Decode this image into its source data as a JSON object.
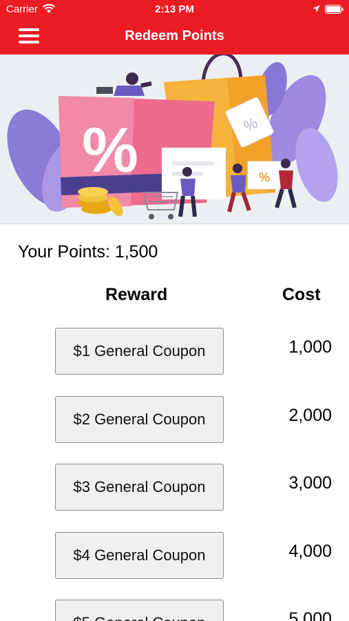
{
  "status_bar": {
    "carrier": "Carrier",
    "time": "2:13 PM",
    "icons": [
      "wifi-icon",
      "location-arrow-icon",
      "battery-icon"
    ]
  },
  "header": {
    "title": "Redeem Points",
    "menu_icon": "hamburger-menu-icon",
    "background_color": "#ec1c24"
  },
  "banner": {
    "illustration": "shopping-discount-illustration",
    "tag_symbol": "%"
  },
  "points": {
    "text": "Your Points: 1,500"
  },
  "table": {
    "reward_header": "Reward",
    "cost_header": "Cost",
    "rows": [
      {
        "label": "$1 General Coupon",
        "cost": "1,000"
      },
      {
        "label": "$2 General Coupon",
        "cost": "2,000"
      },
      {
        "label": "$3 General Coupon",
        "cost": "3,000"
      },
      {
        "label": "$4 General Coupon",
        "cost": "4,000"
      },
      {
        "label": "$5 General Coupon",
        "cost": "5,000"
      }
    ]
  }
}
